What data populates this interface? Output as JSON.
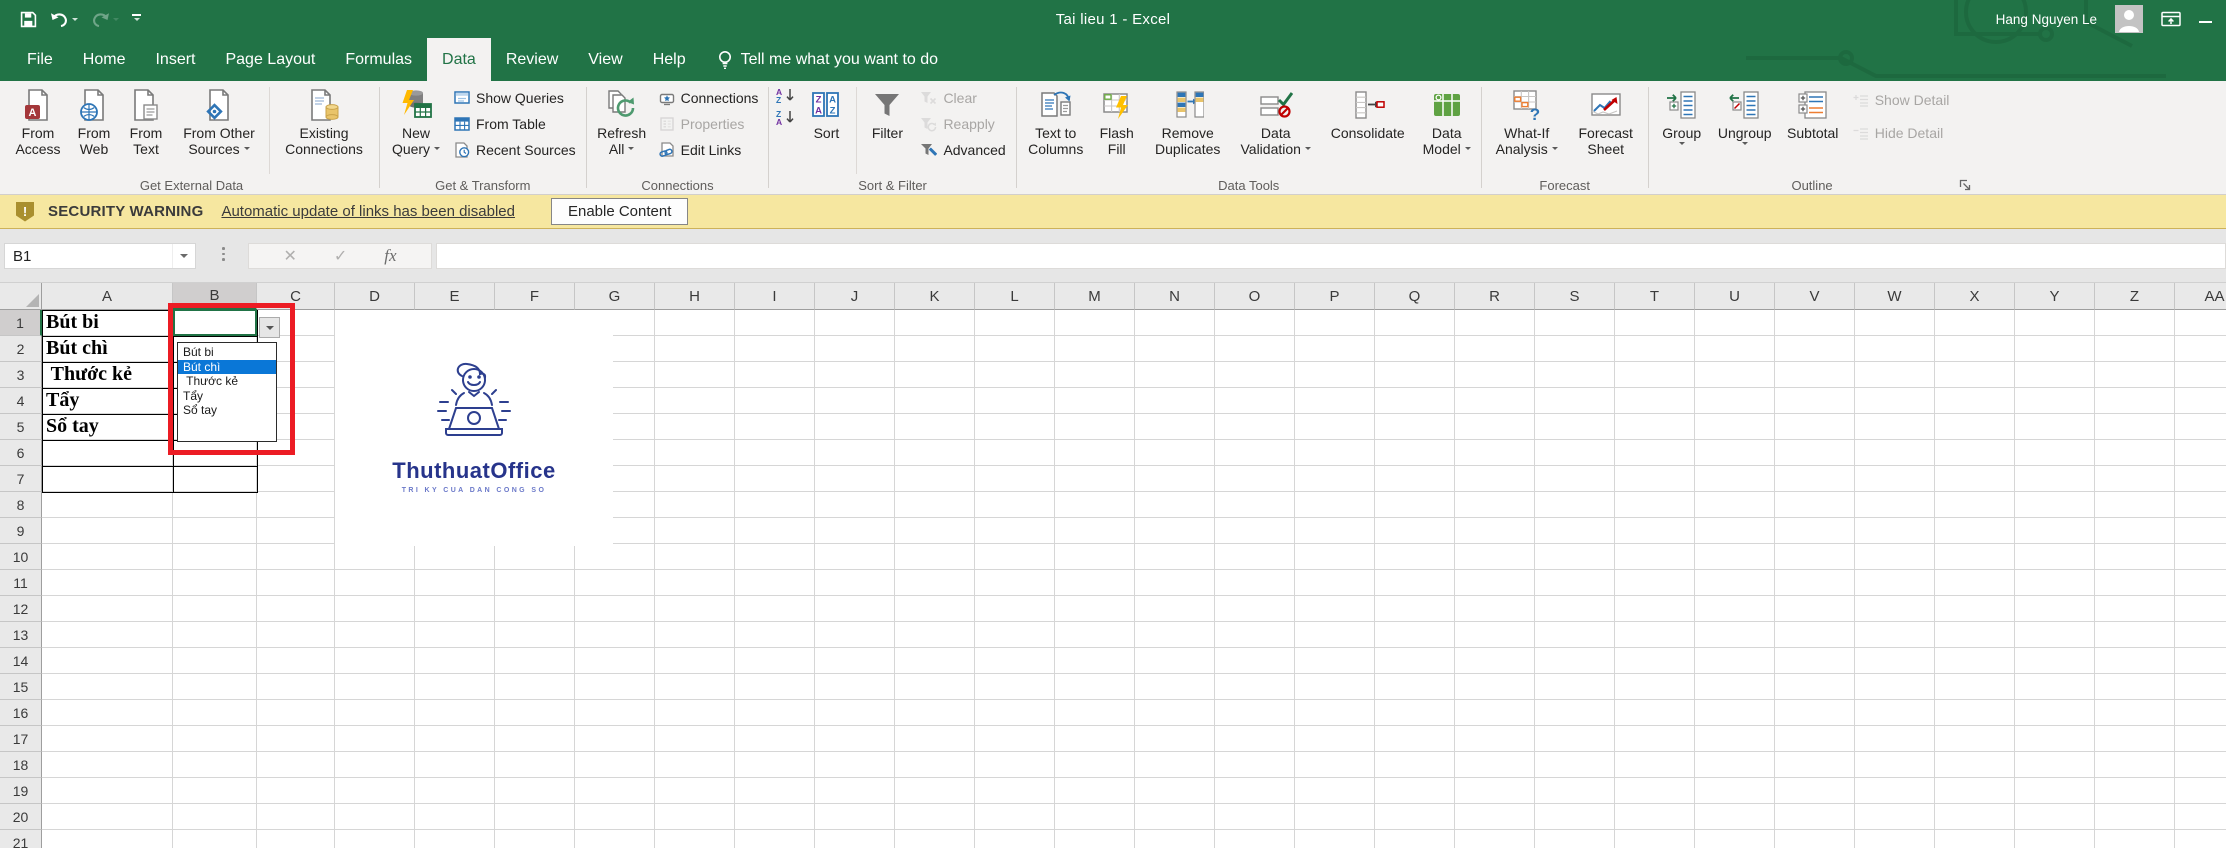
{
  "title_bar": {
    "title": "Tai lieu 1  -  Excel",
    "user": "Hang Nguyen Le"
  },
  "tabs": {
    "active": "Data",
    "items": [
      {
        "label": "File"
      },
      {
        "label": "Home"
      },
      {
        "label": "Insert"
      },
      {
        "label": "Page Layout"
      },
      {
        "label": "Formulas"
      },
      {
        "label": "Data"
      },
      {
        "label": "Review"
      },
      {
        "label": "View"
      },
      {
        "label": "Help"
      }
    ]
  },
  "tell_me": "Tell me what you want to do",
  "ribbon": {
    "groups": [
      {
        "label": "Get External Data",
        "items": [
          {
            "label": "From Access"
          },
          {
            "label": "From Web"
          },
          {
            "label": "From Text"
          },
          {
            "label": "From Other Sources",
            "caret": true
          },
          {
            "label": "Existing Connections"
          }
        ]
      },
      {
        "label": "Get & Transform",
        "items": [
          {
            "label": "New Query",
            "caret": true
          },
          {
            "label": "Show Queries"
          },
          {
            "label": "From Table"
          },
          {
            "label": "Recent Sources"
          }
        ]
      },
      {
        "label": "Connections",
        "items": [
          {
            "label": "Refresh All",
            "caret": true
          },
          {
            "label": "Connections"
          },
          {
            "label": "Properties",
            "disabled": true
          },
          {
            "label": "Edit Links"
          }
        ]
      },
      {
        "label": "Sort & Filter",
        "items": [
          {
            "label": "Sort"
          },
          {
            "label": "Filter"
          },
          {
            "label": "Clear",
            "disabled": true
          },
          {
            "label": "Reapply",
            "disabled": true
          },
          {
            "label": "Advanced"
          }
        ]
      },
      {
        "label": "Data Tools",
        "items": [
          {
            "label": "Text to Columns"
          },
          {
            "label": "Flash Fill"
          },
          {
            "label": "Remove Duplicates"
          },
          {
            "label": "Data Validation",
            "caret": true
          },
          {
            "label": "Consolidate"
          },
          {
            "label": "Data Model",
            "caret": true
          }
        ]
      },
      {
        "label": "Forecast",
        "items": [
          {
            "label": "What-If Analysis",
            "caret": true
          },
          {
            "label": "Forecast Sheet"
          }
        ]
      },
      {
        "label": "Outline",
        "items": [
          {
            "label": "Group",
            "caret": true
          },
          {
            "label": "Ungroup",
            "caret": true
          },
          {
            "label": "Subtotal"
          },
          {
            "label": "Show Detail",
            "disabled": true
          },
          {
            "label": "Hide Detail",
            "disabled": true
          }
        ]
      }
    ]
  },
  "security_bar": {
    "label": "SECURITY WARNING",
    "message": "Automatic update of links has been disabled",
    "button": "Enable Content"
  },
  "formula_bar": {
    "name_box": "B1",
    "formula": ""
  },
  "sheet": {
    "columns": [
      "A",
      "B",
      "C",
      "D",
      "E",
      "F",
      "G",
      "H",
      "I",
      "J",
      "K",
      "L",
      "M",
      "N",
      "O",
      "P",
      "Q",
      "R",
      "S",
      "T",
      "U",
      "V",
      "W",
      "X",
      "Y",
      "Z",
      "AA"
    ],
    "row_count": 21,
    "selected_column": "B",
    "selected_row": 1,
    "active_cell": "B1",
    "cells": [
      {
        "ref": "A1",
        "value": "Bút bi"
      },
      {
        "ref": "A2",
        "value": "Bút chì"
      },
      {
        "ref": "A3",
        "value": " Thước kẻ"
      },
      {
        "ref": "A4",
        "value": "Tẩy"
      },
      {
        "ref": "A5",
        "value": "Sổ tay"
      }
    ],
    "dropdown": {
      "cell": "B1",
      "options": [
        "Bút bi",
        "Bút chì",
        " Thước kẻ",
        "Tẩy",
        "Sổ tay"
      ],
      "highlighted_index": 1,
      "highlighted_value": "Bút chì"
    }
  },
  "logo": {
    "title": "ThuthuatOffice",
    "tagline": "TRI KY CUA DAN CONG SO"
  },
  "colors": {
    "excel_green": "#217346",
    "dropdown_highlight": "#0a77d7",
    "annotation_red": "#ec1c24",
    "security_bg": "#f6e7a0",
    "logo_navy": "#27348b"
  }
}
